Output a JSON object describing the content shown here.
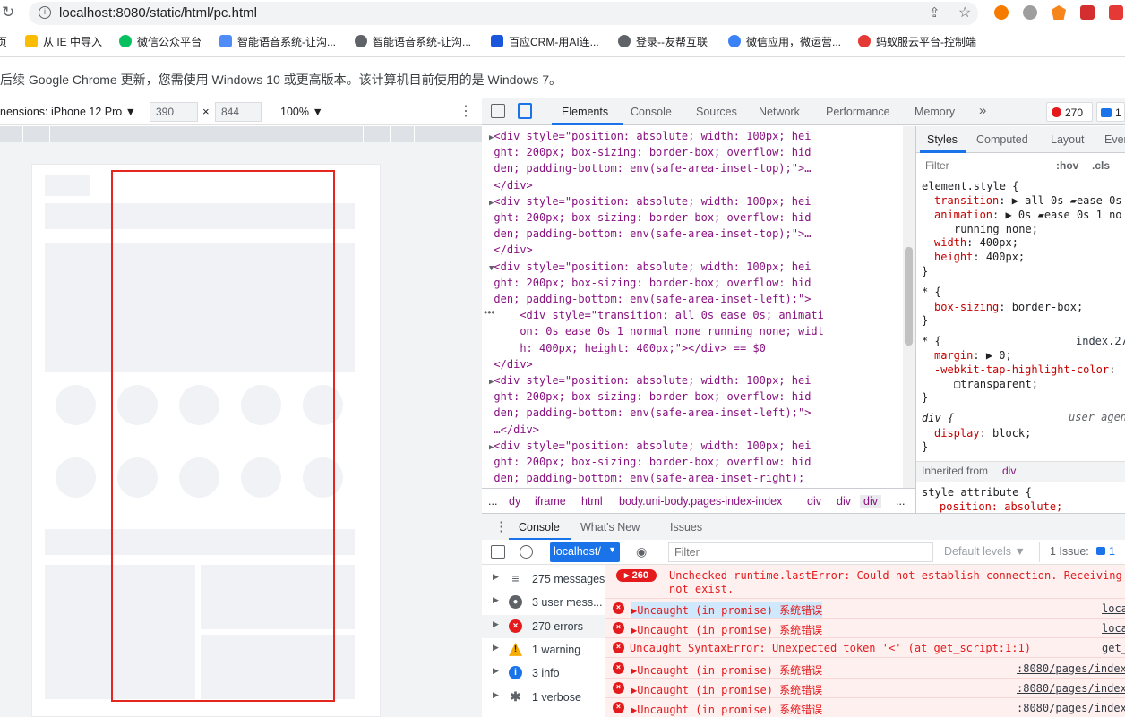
{
  "browser": {
    "url": "localhost:8080/static/html/pc.html",
    "bookmarks": [
      "页",
      "从 IE 中导入",
      "微信公众平台",
      "智能语音系统-让沟...",
      "智能语音系统-让沟...",
      "百应CRM-用AI连...",
      "登录--友帮互联",
      "微信应用，微运营...",
      "蚂蚁服云平台-控制端"
    ],
    "colors": {
      "accent": "#1a73e8",
      "danger": "#e41a1c"
    }
  },
  "infobar": {
    "text": "后续 Google Chrome 更新，您需使用 Windows 10 或更高版本。该计算机目前使用的是 Windows 7。"
  },
  "device_toolbar": {
    "dimensions_label": "nensions: iPhone 12 Pro ▼",
    "width": "390",
    "times": "×",
    "height": "844",
    "zoom": "100% ▼"
  },
  "devtools": {
    "tabs": [
      "Elements",
      "Console",
      "Sources",
      "Network",
      "Performance",
      "Memory",
      "»"
    ],
    "error_count": "270",
    "issue_count": "1",
    "elements_lines": [
      {
        "indent": "  ",
        "tri": "▶",
        "code": "<div style=\"position: absolute; width: 100px; hei"
      },
      {
        "indent": "  ",
        "tri": "",
        "code": "ght: 200px; box-sizing: border-box; overflow: hid"
      },
      {
        "indent": "  ",
        "tri": "",
        "code": "den; padding-bottom: env(safe-area-inset-top);\">…"
      },
      {
        "indent": "  ",
        "tri": "",
        "code": "</div>"
      },
      {
        "indent": "  ",
        "tri": "▶",
        "code": "<div style=\"position: absolute; width: 100px; hei"
      },
      {
        "indent": "  ",
        "tri": "",
        "code": "ght: 200px; box-sizing: border-box; overflow: hid"
      },
      {
        "indent": "  ",
        "tri": "",
        "code": "den; padding-bottom: env(safe-area-inset-top);\">…"
      },
      {
        "indent": "  ",
        "tri": "",
        "code": "</div>"
      },
      {
        "indent": "  ",
        "tri": "▼",
        "code": "<div style=\"position: absolute; width: 100px; hei"
      },
      {
        "indent": "  ",
        "tri": "",
        "code": "ght: 200px; box-sizing: border-box; overflow: hid"
      },
      {
        "indent": "  ",
        "tri": "",
        "code": "den; padding-bottom: env(safe-area-inset-left);\">"
      },
      {
        "indent": "    ",
        "tri": "",
        "code": "<div style=\"transition: all 0s ease 0s; animati"
      },
      {
        "indent": "    ",
        "tri": "",
        "code": "on: 0s ease 0s 1 normal none running none; widt"
      },
      {
        "indent": "    ",
        "tri": "",
        "code": "h: 400px; height: 400px;\"></div> == $0"
      },
      {
        "indent": "  ",
        "tri": "",
        "code": "</div>"
      },
      {
        "indent": "  ",
        "tri": "▶",
        "code": "<div style=\"position: absolute; width: 100px; hei"
      },
      {
        "indent": "  ",
        "tri": "",
        "code": "ght: 200px; box-sizing: border-box; overflow: hid"
      },
      {
        "indent": "  ",
        "tri": "",
        "code": "den; padding-bottom: env(safe-area-inset-left);\">"
      },
      {
        "indent": "  ",
        "tri": "",
        "code": "…</div>"
      },
      {
        "indent": "  ",
        "tri": "▶",
        "code": "<div style=\"position: absolute; width: 100px; hei"
      },
      {
        "indent": "  ",
        "tri": "",
        "code": "ght: 200px; box-sizing: border-box; overflow: hid"
      },
      {
        "indent": "  ",
        "tri": "",
        "code": "den; padding-bottom: env(safe-area-inset-right);"
      }
    ],
    "breadcrumbs": [
      "...",
      "dy",
      "iframe",
      "html",
      "body.uni-body.pages-index-index",
      "div",
      "div",
      "div",
      "..."
    ],
    "styles_tabs": [
      "Styles",
      "Computed",
      "Layout",
      "Even"
    ],
    "styles_filter_placeholder": "Filter",
    "hov": ":hov",
    "cls": ".cls",
    "styles_lines": [
      {
        "kind": "sel",
        "text": "element.style {"
      },
      {
        "kind": "prop",
        "name": "transition",
        "value": "▶ all 0s ▰ease 0s"
      },
      {
        "kind": "prop",
        "name": "animation",
        "value": "▶ 0s ▰ease 0s 1 no"
      },
      {
        "kind": "cont",
        "text": "running none;"
      },
      {
        "kind": "prop",
        "name": "width",
        "value": "400px;"
      },
      {
        "kind": "prop",
        "name": "height",
        "value": "400px;"
      },
      {
        "kind": "sel",
        "text": "}"
      },
      {
        "kind": "sel",
        "text": "* {"
      },
      {
        "kind": "prop",
        "name": "box-sizing",
        "value": "border-box;"
      },
      {
        "kind": "sel",
        "text": "}"
      },
      {
        "kind": "sel",
        "text": "* {"
      },
      {
        "kind": "prop",
        "name": "margin",
        "value": "▶ 0;"
      },
      {
        "kind": "prop",
        "name": "-webkit-tap-highlight-color",
        "value": ""
      },
      {
        "kind": "cont",
        "text": "  ▢transparent;"
      },
      {
        "kind": "sel",
        "text": "}"
      },
      {
        "kind": "sel",
        "text": "div {"
      },
      {
        "kind": "prop",
        "name": "display",
        "value": "block;"
      },
      {
        "kind": "sel",
        "text": "}"
      }
    ],
    "styles_source": "index.27",
    "user_agent": "user agen",
    "inherited_label": "Inherited from",
    "inherited_tag": "div",
    "style_attr": "style attribute {",
    "style_attr_prop": "position: absolute;",
    "drawer_tabs": [
      "Console",
      "What's New",
      "Issues"
    ],
    "context": "localhost/",
    "console_filter_placeholder": "Filter",
    "default_levels": "Default levels ▼",
    "issue_badge": "1 Issue: ",
    "issue_badge_count": "1",
    "sidebar": [
      {
        "label": "275 messages",
        "icon": "list-icon"
      },
      {
        "label": "3 user mess...",
        "icon": "user-icon"
      },
      {
        "label": "270 errors",
        "icon": "error-icon"
      },
      {
        "label": "1 warning",
        "icon": "warning-icon"
      },
      {
        "label": "3 info",
        "icon": "info-icon"
      },
      {
        "label": "1 verbose",
        "icon": "verbose-icon"
      }
    ],
    "first_message": {
      "count": "260",
      "line1": "Unchecked runtime.lastError: Could not establish connection. Receiving",
      "line2": "not exist."
    },
    "messages": [
      {
        "text": "▶Uncaught (in promise) 系统错误",
        "src": "loca"
      },
      {
        "text": "▶Uncaught (in promise) 系统错误",
        "src": "loca"
      },
      {
        "text": "Uncaught SyntaxError: Unexpected token '<' (at get_script:1:1)",
        "src": "get_"
      },
      {
        "text": "▶Uncaught (in promise) 系统错误",
        "src": ":8080/pages/index"
      },
      {
        "text": "▶Uncaught (in promise) 系统错误",
        "src": ":8080/pages/index"
      },
      {
        "text": "▶Uncaught (in promise) 系统错误",
        "src": ":8080/pages/index"
      }
    ]
  }
}
